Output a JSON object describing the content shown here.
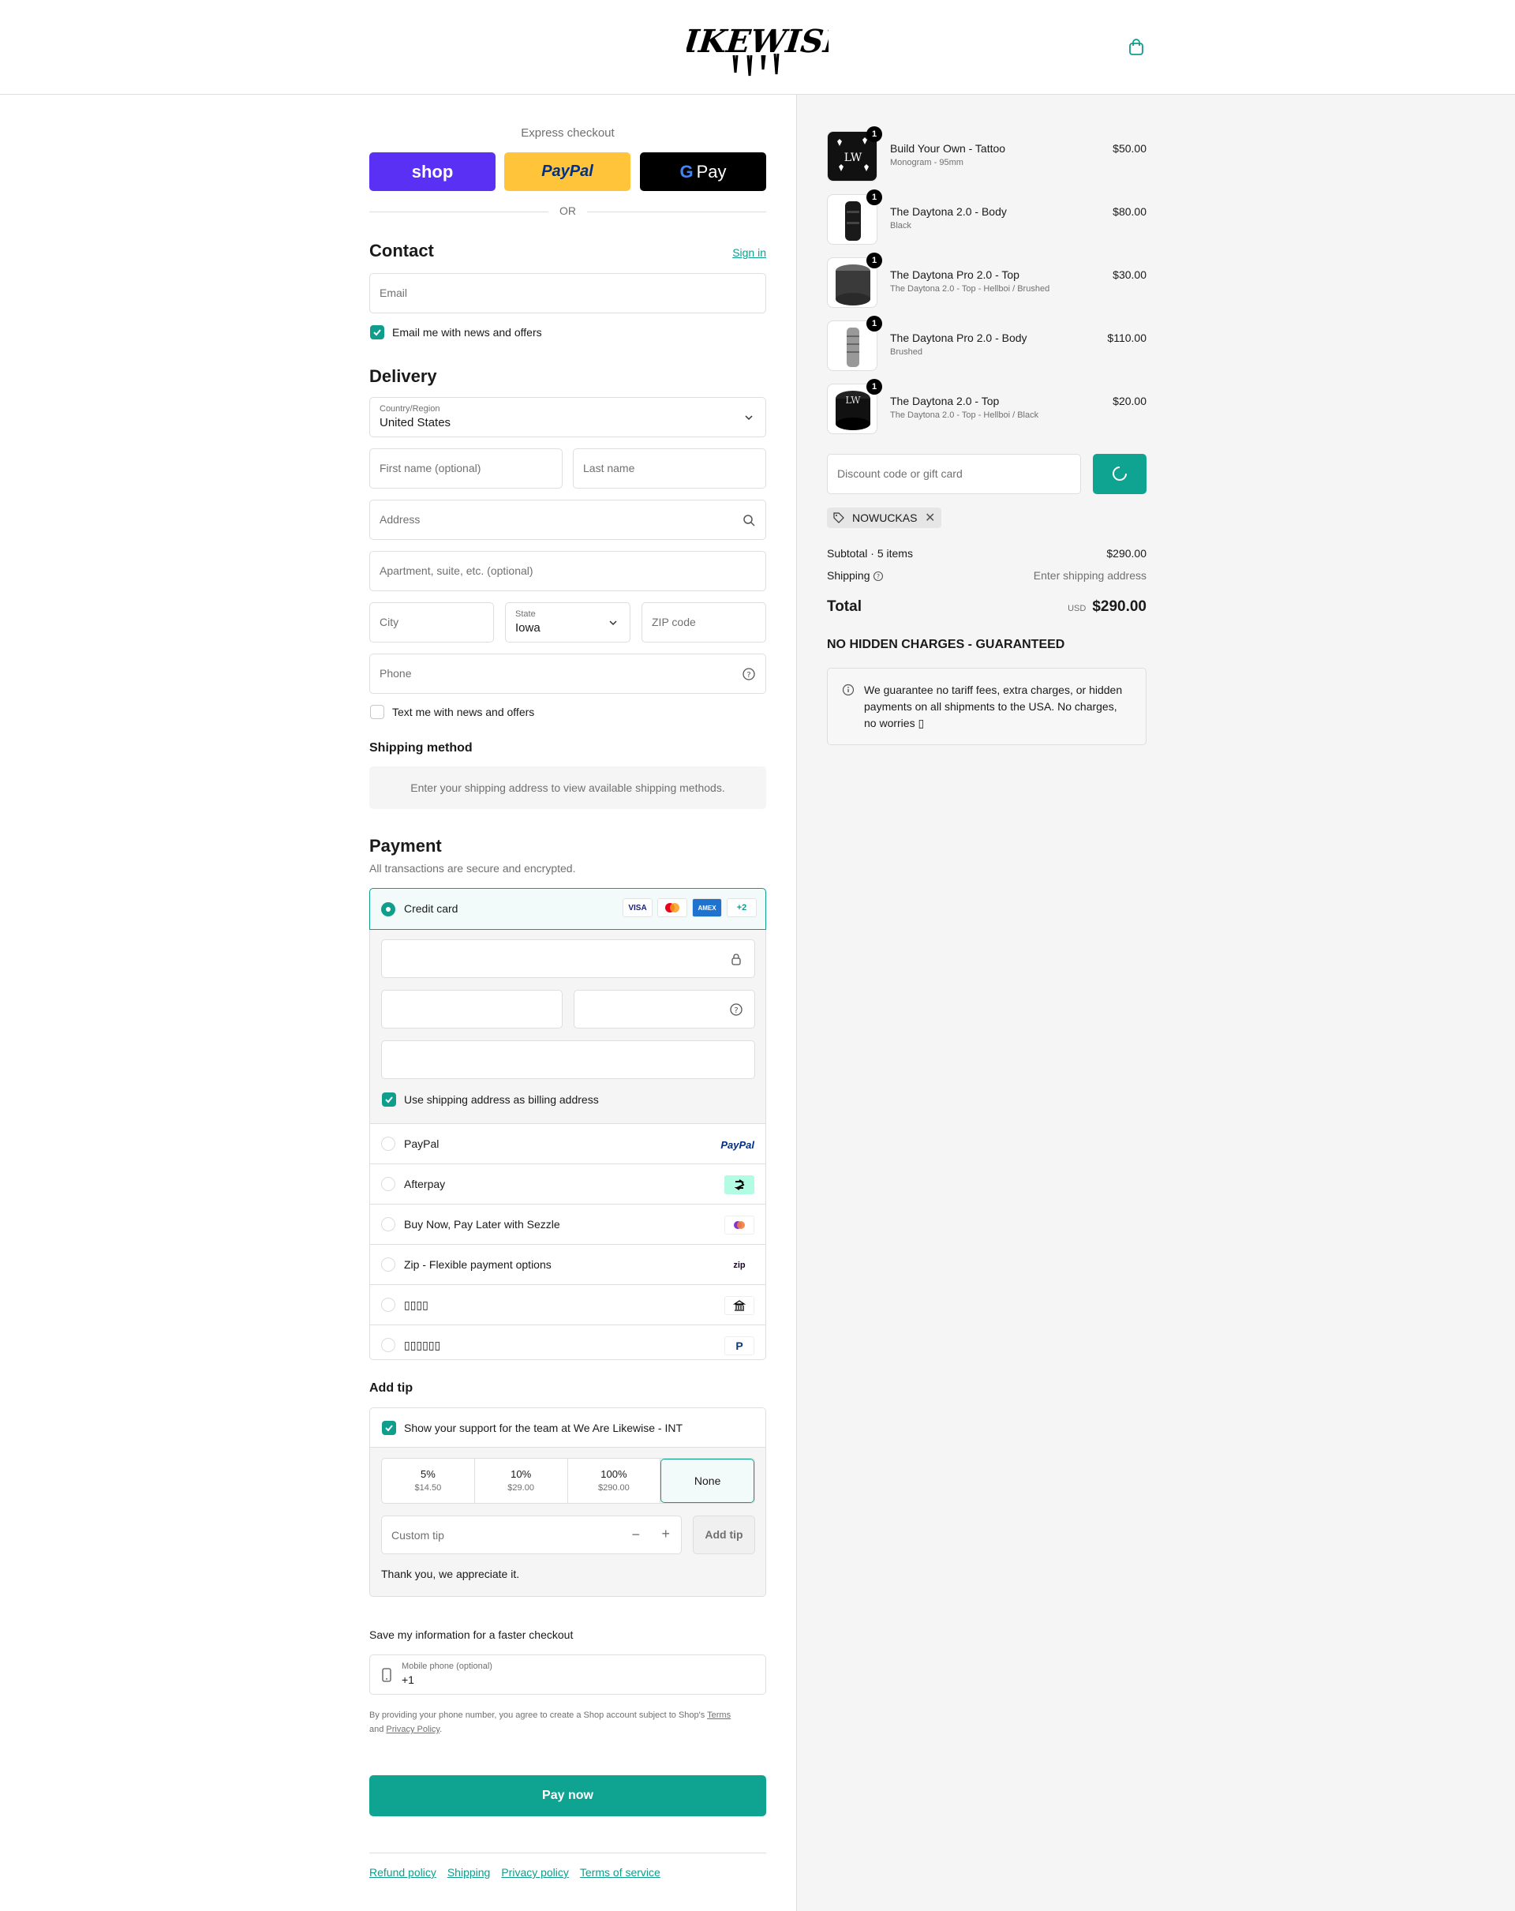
{
  "brand": {
    "name": "LIKEWISE",
    "accent": "#0f9d8c"
  },
  "express": {
    "label": "Express checkout",
    "shop": "shop",
    "paypal": "PayPal",
    "gpay": "Pay",
    "or": "OR"
  },
  "contact": {
    "title": "Contact",
    "signin": "Sign in",
    "email_placeholder": "Email",
    "news_label": "Email me with news and offers"
  },
  "delivery": {
    "title": "Delivery",
    "country_label": "Country/Region",
    "country_value": "United States",
    "first_name": "First name (optional)",
    "last_name": "Last name",
    "address": "Address",
    "apartment": "Apartment, suite, etc. (optional)",
    "city": "City",
    "state_label": "State",
    "state_value": "Iowa",
    "zip": "ZIP code",
    "phone": "Phone",
    "text_label": "Text me with news and offers"
  },
  "shipping_method": {
    "title": "Shipping method",
    "message": "Enter your shipping address to view available shipping methods."
  },
  "payment": {
    "title": "Payment",
    "subtitle": "All transactions are secure and encrypted.",
    "credit_card": "Credit card",
    "more_cards": "+2",
    "billing_same": "Use shipping address as billing address",
    "methods": [
      {
        "label": "PayPal",
        "logo": "PayPal"
      },
      {
        "label": "Afterpay",
        "logo": "afterpay-icon"
      },
      {
        "label": "Buy Now, Pay Later with Sezzle",
        "logo": "sezzle-icon"
      },
      {
        "label": "Zip - Flexible payment options",
        "logo": "zip"
      },
      {
        "label": "▯▯▯▯",
        "logo": "bank-icon"
      },
      {
        "label": "▯▯▯▯▯▯",
        "logo": "paidy-icon"
      }
    ]
  },
  "tip": {
    "title": "Add tip",
    "support_label": "Show your support for the team at We Are Likewise - INT",
    "options": [
      {
        "pct": "5%",
        "amt": "$14.50"
      },
      {
        "pct": "10%",
        "amt": "$29.00"
      },
      {
        "pct": "100%",
        "amt": "$290.00"
      }
    ],
    "none": "None",
    "custom_placeholder": "Custom tip",
    "add_button": "Add tip",
    "thanks": "Thank you, we appreciate it."
  },
  "save_info": {
    "title": "Save my information for a faster checkout",
    "phone_label": "Mobile phone (optional)",
    "phone_value": "+1",
    "legal_1": "By providing your phone number, you agree to create a Shop account subject to Shop's",
    "terms": "Terms",
    "and": "and",
    "privacy": "Privacy Policy",
    "period": "."
  },
  "pay_now": "Pay now",
  "footer": {
    "refund": "Refund policy",
    "shipping": "Shipping",
    "privacy": "Privacy policy",
    "terms": "Terms of service"
  },
  "order": {
    "items": [
      {
        "name": "Build Your Own - Tattoo",
        "variant": "Monogram - 95mm",
        "price": "$50.00",
        "qty": "1"
      },
      {
        "name": "The Daytona 2.0 - Body",
        "variant": "Black",
        "price": "$80.00",
        "qty": "1"
      },
      {
        "name": "The Daytona Pro 2.0 - Top",
        "variant": "The Daytona 2.0 - Top - Hellboi / Brushed",
        "price": "$30.00",
        "qty": "1"
      },
      {
        "name": "The Daytona Pro 2.0 - Body",
        "variant": "Brushed",
        "price": "$110.00",
        "qty": "1"
      },
      {
        "name": "The Daytona 2.0 - Top",
        "variant": "The Daytona 2.0 - Top - Hellboi / Black",
        "price": "$20.00",
        "qty": "1"
      }
    ],
    "discount_placeholder": "Discount code or gift card",
    "applied_code": "NOWUCKAS",
    "subtotal_label": "Subtotal · 5 items",
    "subtotal_value": "$290.00",
    "shipping_label": "Shipping",
    "shipping_value": "Enter shipping address",
    "total_label": "Total",
    "currency": "USD",
    "total_value": "$290.00",
    "guarantee_title": "NO HIDDEN CHARGES - GUARANTEED",
    "guarantee_text": "We guarantee no tariff fees, extra charges, or hidden payments on all shipments to the USA. No charges, no worries ▯"
  }
}
